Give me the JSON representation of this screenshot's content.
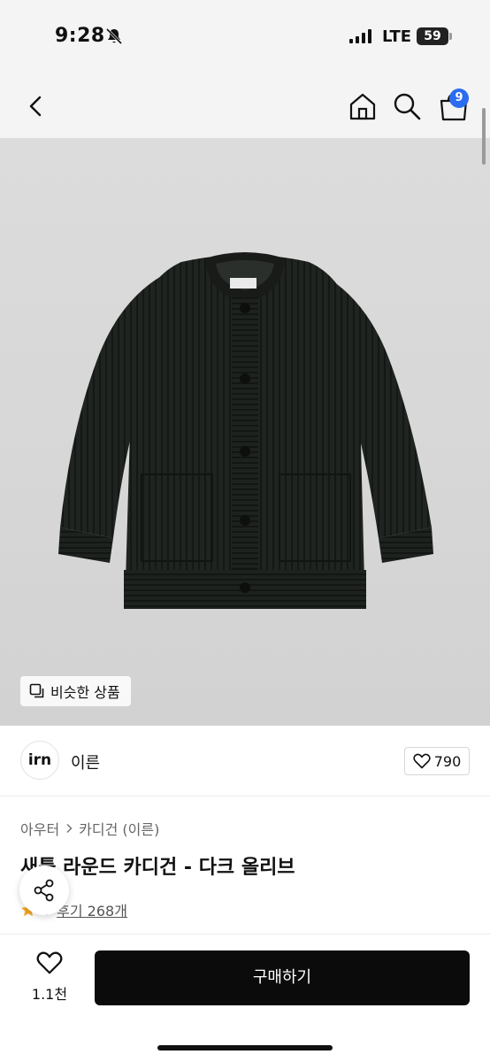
{
  "status_bar": {
    "time": "9:28",
    "network": "LTE",
    "battery": "59"
  },
  "nav": {
    "cart_count": "9"
  },
  "image": {
    "similar_label": "비슷한 상품"
  },
  "brand": {
    "logo_text": "irn",
    "name": "이른",
    "likes": "790"
  },
  "product": {
    "breadcrumb": [
      "아우터",
      "카디건 (이른)"
    ],
    "title": "새틀 라운드 카디건 - 다크 올리브",
    "rating": "5",
    "reviews": "후기 268개"
  },
  "bottom_bar": {
    "wish_count": "1.1천",
    "buy_label": "구매하기"
  },
  "colors": {
    "accent": "#2b6cf0",
    "buy_button": "#0b0b0b",
    "star": "#f5a623",
    "garment": "#1f2420"
  }
}
